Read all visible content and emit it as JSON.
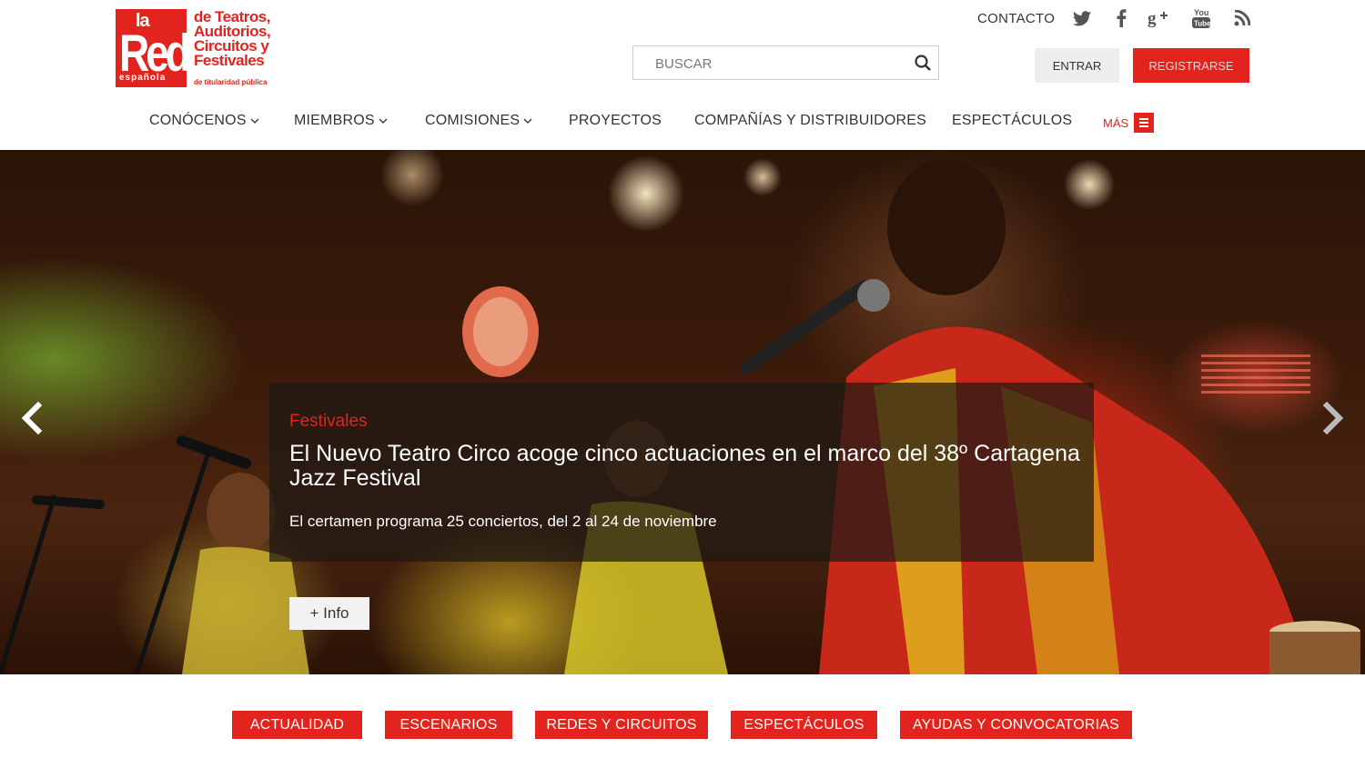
{
  "logo": {
    "la": "la",
    "red": "Red",
    "espanola": "española",
    "tagline_lines": [
      "de Teatros,",
      "Auditorios,",
      "Circuitos y",
      "Festivales"
    ],
    "subtitle": "de titularidad pública"
  },
  "top": {
    "contact_label": "CONTACTO",
    "social_icons": [
      "twitter-icon",
      "facebook-icon",
      "google-plus-icon",
      "youtube-icon",
      "rss-icon"
    ]
  },
  "search": {
    "placeholder": "BUSCAR"
  },
  "auth": {
    "login_label": "ENTRAR",
    "register_label": "REGISTRARSE"
  },
  "nav": {
    "items": [
      {
        "label": "CONÓCENOS",
        "dropdown": true
      },
      {
        "label": "MIEMBROS",
        "dropdown": true
      },
      {
        "label": "COMISIONES",
        "dropdown": true
      },
      {
        "label": "PROYECTOS",
        "dropdown": false
      },
      {
        "label": "COMPAÑÍAS Y DISTRIBUIDORES",
        "dropdown": false
      },
      {
        "label": "ESPECTÁCULOS",
        "dropdown": false
      }
    ],
    "more_label": "MÁS"
  },
  "hero": {
    "category": "Festivales",
    "title": "El Nuevo Teatro Circo acoge cinco actuaciones en el marco del 38º Cartagena Jazz Festival",
    "description": "El certamen programa 25 conciertos, del 2 al 24 de noviembre",
    "info_button": "+ Info"
  },
  "tabs": [
    "ACTUALIDAD",
    "ESCENARIOS",
    "REDES Y CIRCUITOS",
    "ESPECTÁCULOS",
    "AYUDAS Y CONVOCATORIAS"
  ],
  "colors": {
    "accent": "#e3231d",
    "text": "#333333",
    "button_light": "#eeeeee"
  }
}
